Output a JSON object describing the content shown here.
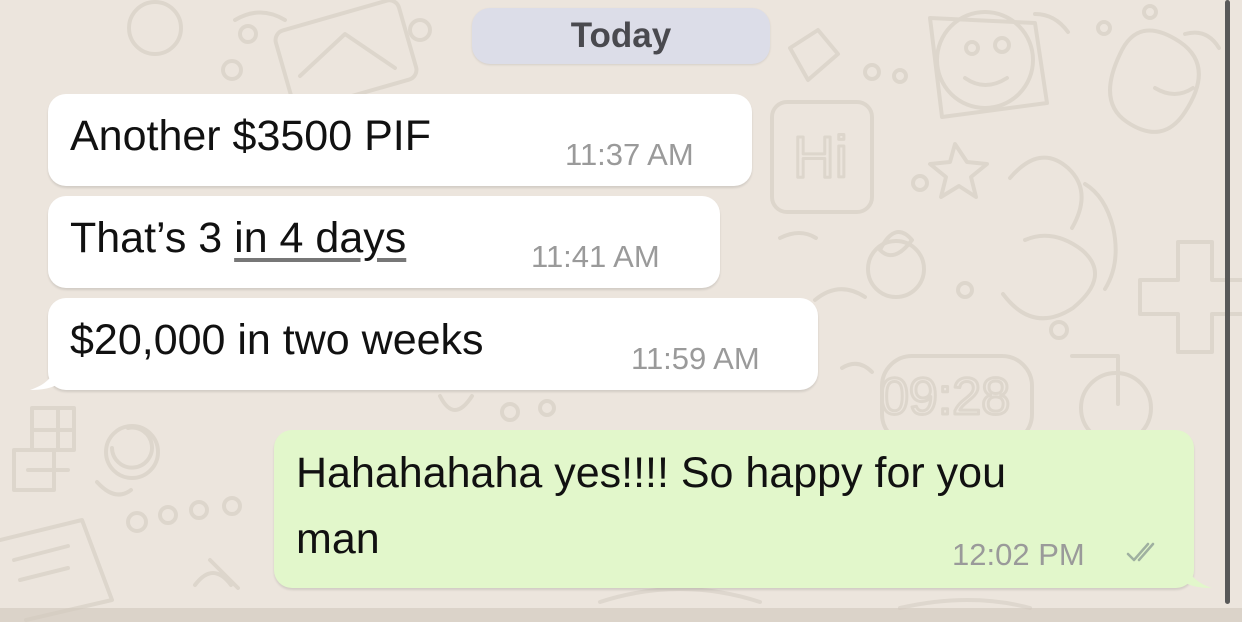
{
  "date_separator": "Today",
  "messages": [
    {
      "direction": "incoming",
      "text": "Another $3500 PIF",
      "time": "11:37 AM"
    },
    {
      "direction": "incoming",
      "text_prefix": "That’s 3 ",
      "text_link": "in 4 days",
      "time": "11:41 AM"
    },
    {
      "direction": "incoming",
      "text": "$20,000 in two weeks",
      "time": "11:59 AM"
    },
    {
      "direction": "outgoing",
      "text_line1": "Hahahahaha yes!!!! So happy for you",
      "text_line2": "man",
      "time": "12:02 PM",
      "status_icon": "double-check-icon"
    }
  ],
  "colors": {
    "wallpaper": "#ece5dd",
    "incoming_bubble": "#ffffff",
    "outgoing_bubble": "#e2f7cb",
    "date_pill": "#dcdde8",
    "timestamp": "#9a9a9a"
  }
}
